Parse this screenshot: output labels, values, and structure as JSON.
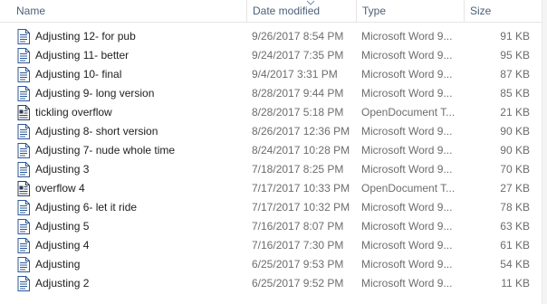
{
  "columns": {
    "name": "Name",
    "date_modified": "Date modified",
    "type": "Type",
    "size": "Size"
  },
  "sort": {
    "column": "date_modified",
    "direction": "descending"
  },
  "files": [
    {
      "name": "Adjusting 12- for pub",
      "date": "9/26/2017 8:54 PM",
      "type": "Microsoft Word 9...",
      "size": "91 KB",
      "icon": "word-document-icon"
    },
    {
      "name": "Adjusting 11- better",
      "date": "9/24/2017 7:35 PM",
      "type": "Microsoft Word 9...",
      "size": "95 KB",
      "icon": "word-document-icon"
    },
    {
      "name": "Adjusting 10- final",
      "date": "9/4/2017 3:31 PM",
      "type": "Microsoft Word 9...",
      "size": "87 KB",
      "icon": "word-document-icon"
    },
    {
      "name": "Adjusting 9- long version",
      "date": "8/28/2017 9:44 PM",
      "type": "Microsoft Word 9...",
      "size": "85 KB",
      "icon": "word-document-icon"
    },
    {
      "name": "tickling overflow",
      "date": "8/28/2017 5:18 PM",
      "type": "OpenDocument T...",
      "size": "21 KB",
      "icon": "opendocument-text-icon"
    },
    {
      "name": "Adjusting 8- short version",
      "date": "8/26/2017 12:36 PM",
      "type": "Microsoft Word 9...",
      "size": "90 KB",
      "icon": "word-document-icon"
    },
    {
      "name": "Adjusting 7- nude whole time",
      "date": "8/24/2017 10:28 PM",
      "type": "Microsoft Word 9...",
      "size": "90 KB",
      "icon": "word-document-icon"
    },
    {
      "name": "Adjusting 3",
      "date": "7/18/2017 8:25 PM",
      "type": "Microsoft Word 9...",
      "size": "70 KB",
      "icon": "word-document-icon"
    },
    {
      "name": "overflow 4",
      "date": "7/17/2017 10:33 PM",
      "type": "OpenDocument T...",
      "size": "27 KB",
      "icon": "opendocument-text-icon"
    },
    {
      "name": "Adjusting 6- let it ride",
      "date": "7/17/2017 10:32 PM",
      "type": "Microsoft Word 9...",
      "size": "78 KB",
      "icon": "word-document-icon"
    },
    {
      "name": "Adjusting 5",
      "date": "7/16/2017 8:07 PM",
      "type": "Microsoft Word 9...",
      "size": "63 KB",
      "icon": "word-document-icon"
    },
    {
      "name": "Adjusting 4",
      "date": "7/16/2017 7:30 PM",
      "type": "Microsoft Word 9...",
      "size": "61 KB",
      "icon": "word-document-icon"
    },
    {
      "name": "Adjusting",
      "date": "6/25/2017 9:53 PM",
      "type": "Microsoft Word 9...",
      "size": "54 KB",
      "icon": "word-document-icon"
    },
    {
      "name": "Adjusting 2",
      "date": "6/25/2017 9:52 PM",
      "type": "Microsoft Word 9...",
      "size": "11 KB",
      "icon": "word-document-icon"
    }
  ],
  "colors": {
    "header_text": "#4c607a",
    "icon_blue": "#2b5797",
    "meta_text": "#6d6d6d"
  }
}
